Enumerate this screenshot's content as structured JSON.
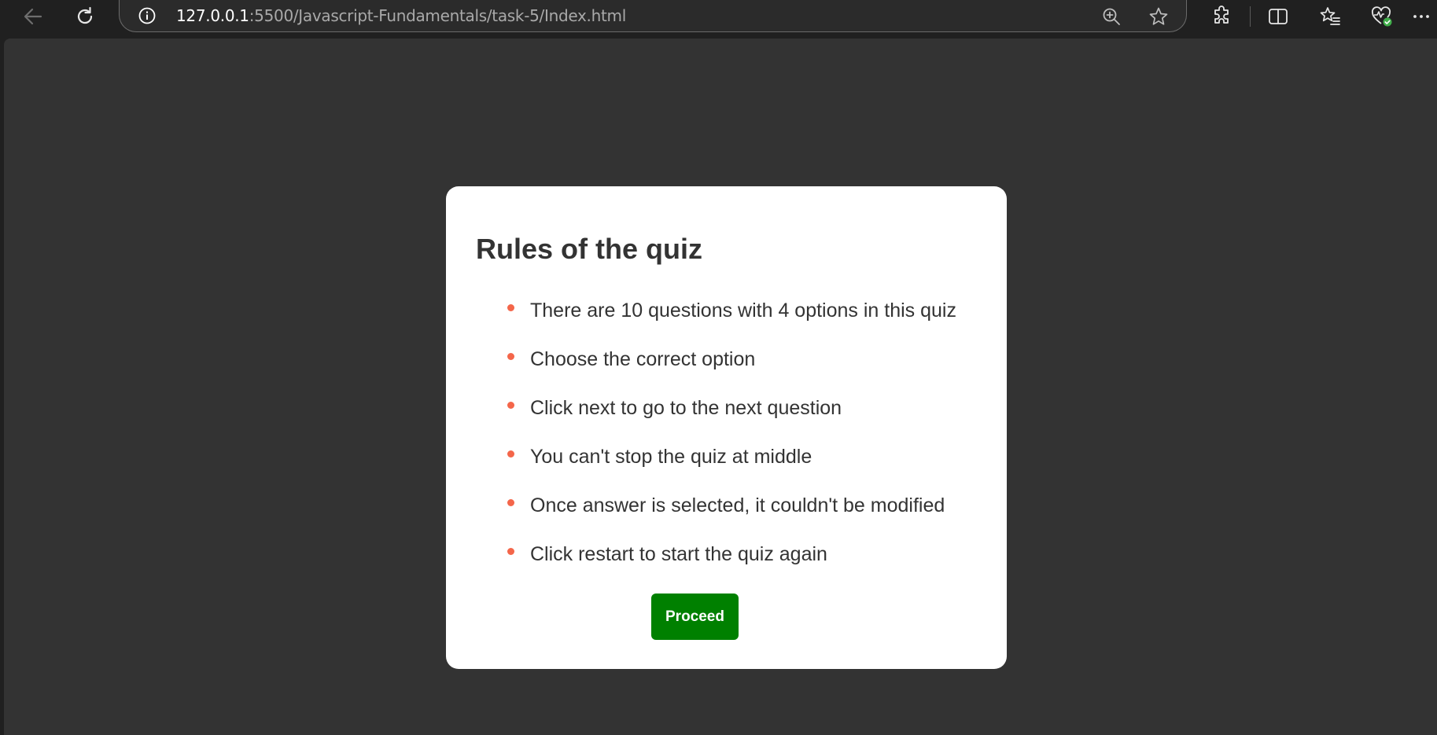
{
  "browser": {
    "url_host": "127.0.0.1",
    "url_rest": ":5500/Javascript-Fundamentals/task-5/Index.html",
    "icons": [
      "back-icon",
      "refresh-icon",
      "site-info-icon",
      "zoom-icon",
      "favorite-star-icon",
      "extensions-icon",
      "split-screen-icon",
      "favorites-icon",
      "browser-essentials-icon",
      "more-icon"
    ]
  },
  "quiz": {
    "title": "Rules of the quiz",
    "rules": [
      "There are 10 questions with 4 options in this quiz",
      "Choose the correct option",
      "Click next to go to the next question",
      "You can't stop the quiz at middle",
      "Once answer is selected, it couldn't be modified",
      "Click restart to start the quiz again"
    ],
    "proceed_label": "Proceed"
  },
  "colors": {
    "page_background": "#333333",
    "card_background": "#ffffff",
    "bullet": "#f4664a",
    "proceed_button": "#008000",
    "browser_chrome": "#202020"
  }
}
